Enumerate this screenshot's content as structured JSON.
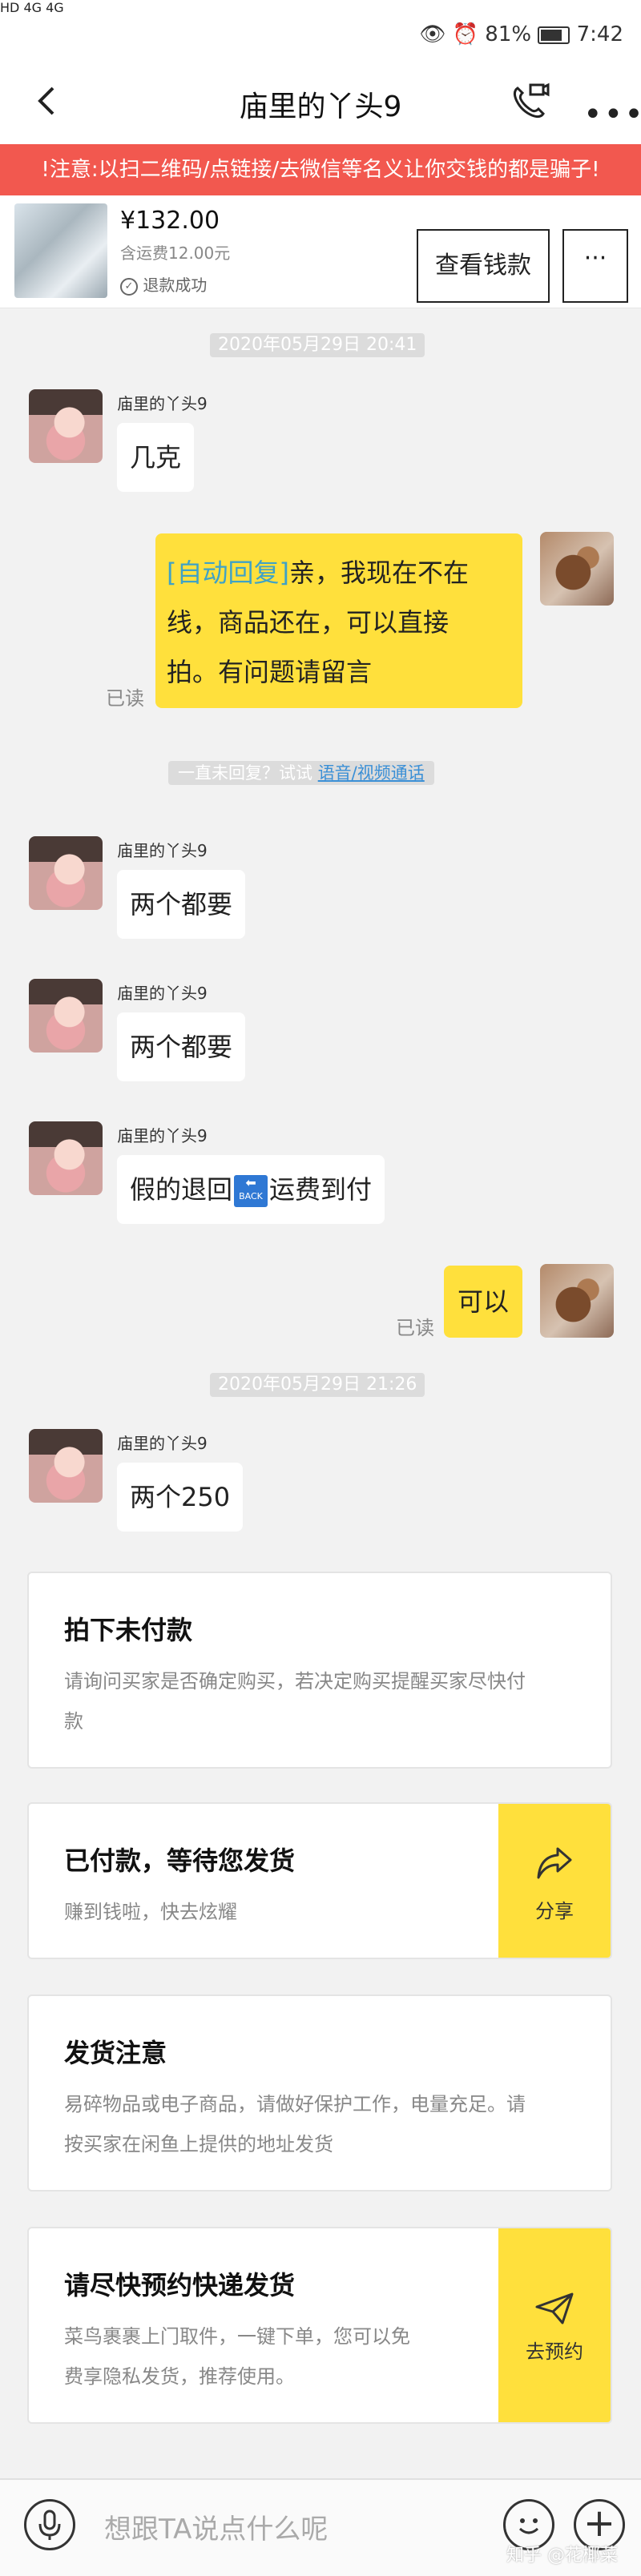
{
  "status_bar": {
    "left_indicators": "HD 4G 4G",
    "battery": "81%",
    "time": "7:42"
  },
  "header": {
    "title": "庙里的丫头9",
    "back_icon": "back-arrow-icon",
    "video_call_icon": "video-call-icon",
    "more_icon": "more-icon",
    "more_label": "•••"
  },
  "warning_banner": "!注意:以扫二维码/点链接/去微信等名义让你交钱的都是骗子!",
  "product": {
    "price": "¥132.00",
    "shipping": "含运费12.00元",
    "status": "退款成功",
    "view_button": "查看钱款",
    "more_button": "···"
  },
  "chat": {
    "timestamp_1": "2020年05月29日 20:41",
    "timestamp_2": "2020年05月29日 21:26",
    "sender_name": "庙里的丫头9",
    "read_label": "已读",
    "auto_reply_tag": "[自动回复]",
    "auto_reply_text_1": "亲，我现在不在",
    "auto_reply_text_2": "线，商品还在，可以直接",
    "auto_reply_text_3": "拍。有问题请留言",
    "hint_prefix": "一直未回复？试试",
    "hint_link": "语音/视频通话",
    "msg_1": "几克",
    "msg_2": "两个都要",
    "msg_3": "两个都要",
    "msg_4_a": "假的退回",
    "msg_4_icon": "BACK",
    "msg_4_b": "运费到付",
    "msg_5": "可以",
    "msg_6": "两个250"
  },
  "cards": {
    "card_1_title": "拍下未付款",
    "card_1_desc_1": "请询问买家是否确定购买，若决定购买提醒买家尽快付",
    "card_1_desc_2": "款",
    "card_2_title": "已付款，等待您发货",
    "card_2_desc": "赚到钱啦，快去炫耀",
    "card_2_action": "分享",
    "card_3_title": "发货注意",
    "card_3_desc_1": "易碎物品或电子商品，请做好保护工作，电量充足。请",
    "card_3_desc_2": "按买家在闲鱼上提供的地址发货",
    "card_4_title": "请尽快预约快递发货",
    "card_4_desc_1": "菜鸟裹裹上门取件，一键下单，您可以免",
    "card_4_desc_2": "费享隐私发货，推荐使用。",
    "card_4_action": "去预约"
  },
  "input_bar": {
    "placeholder": "想跟TA说点什么呢",
    "mic_icon": "microphone-icon",
    "emoji_icon": "emoji-icon",
    "plus_icon": "plus-icon",
    "plus_label": "+"
  },
  "watermark": "知乎 @花椰菜"
}
